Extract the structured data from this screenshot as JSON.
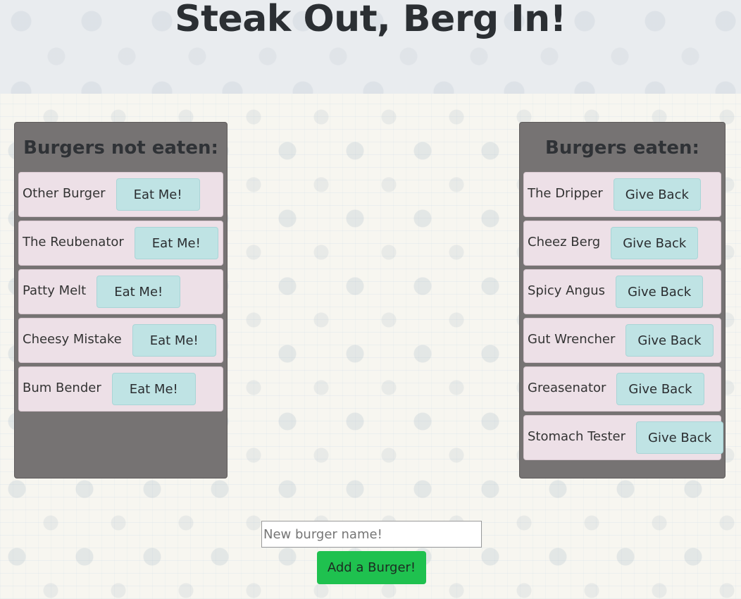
{
  "header": {
    "title": "Steak Out, Berg In!"
  },
  "not_eaten": {
    "title": "Burgers not eaten:",
    "button_label": "Eat Me!",
    "items": [
      {
        "name": "Other Burger"
      },
      {
        "name": "The Reubenator"
      },
      {
        "name": "Patty Melt"
      },
      {
        "name": "Cheesy Mistake"
      },
      {
        "name": "Bum Bender"
      }
    ]
  },
  "eaten": {
    "title": "Burgers eaten:",
    "button_label": "Give Back",
    "items": [
      {
        "name": "The Dripper"
      },
      {
        "name": "Cheez Berg"
      },
      {
        "name": "Spicy Angus"
      },
      {
        "name": "Gut Wrencher"
      },
      {
        "name": "Greasenator"
      },
      {
        "name": "Stomach Tester"
      }
    ]
  },
  "form": {
    "input_placeholder": "New burger name!",
    "input_value": "",
    "submit_label": "Add a Burger!"
  },
  "colors": {
    "panel_bg": "#767373",
    "item_bg": "#ede0e7",
    "item_button_bg": "#bfe3e4",
    "submit_button_bg": "#1fc14f",
    "header_bg": "#e9ecef"
  }
}
